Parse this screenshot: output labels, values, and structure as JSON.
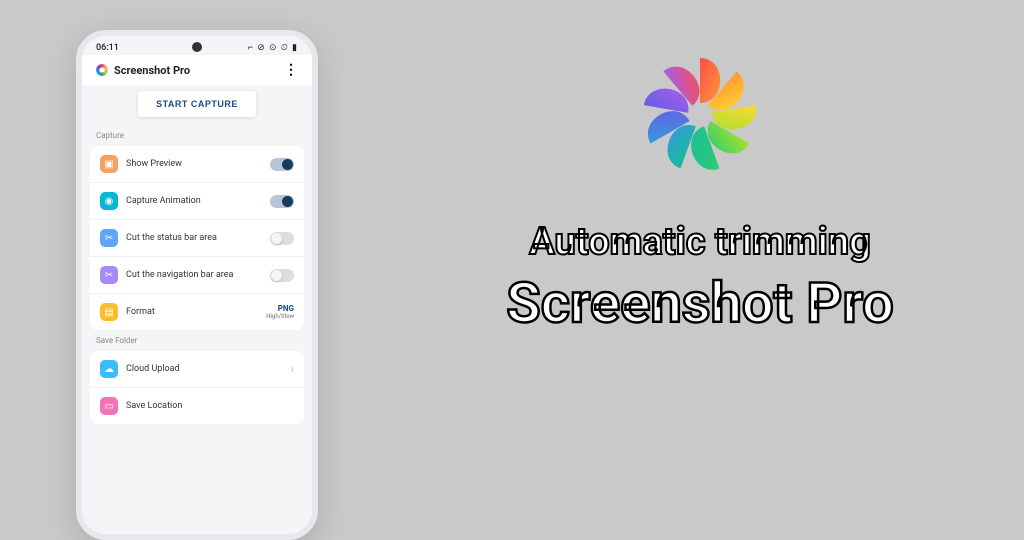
{
  "status": {
    "time": "06:11",
    "icons": "⌐ ⊘ ⊙ ⏲ ▮"
  },
  "app": {
    "title": "Screenshot Pro"
  },
  "buttons": {
    "start": "START CAPTURE"
  },
  "sections": {
    "capture": {
      "label": "Capture",
      "rows": {
        "preview": "Show Preview",
        "animation": "Capture Animation",
        "statusbar": "Cut the status bar area",
        "navbar": "Cut the navigation bar area",
        "format": "Format",
        "format_value": "PNG",
        "format_sub": "High/Slow"
      }
    },
    "save": {
      "label": "Save Folder",
      "rows": {
        "cloud": "Cloud Upload",
        "location": "Save Location"
      }
    }
  },
  "promo": {
    "line1": "Automatic trimming",
    "line2": "Screenshot Pro"
  }
}
